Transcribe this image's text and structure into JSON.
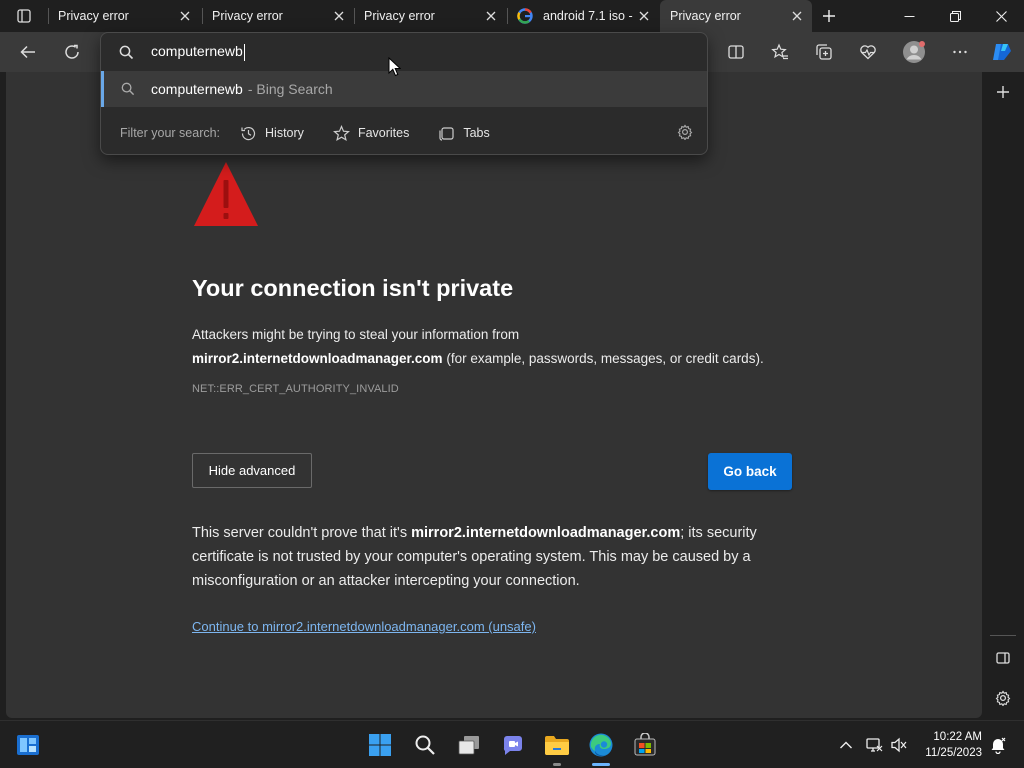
{
  "tabs": [
    {
      "title": "Privacy error",
      "favicon": "privacy-warning-icon"
    },
    {
      "title": "Privacy error",
      "favicon": "privacy-warning-icon"
    },
    {
      "title": "Privacy error",
      "favicon": "privacy-warning-icon"
    },
    {
      "title": "android 7.1 iso -",
      "favicon": "google-icon"
    },
    {
      "title": "Privacy error",
      "favicon": "privacy-warning-icon",
      "active": true
    }
  ],
  "omnibox": {
    "value": "computernewb",
    "suggestion_query": "computernewb",
    "suggestion_source": "- Bing Search",
    "filter_label": "Filter your search:",
    "filters": [
      "History",
      "Favorites",
      "Tabs"
    ]
  },
  "page": {
    "heading": "Your connection isn't private",
    "intro_before": "Attackers might be trying to steal your information from",
    "host": "mirror2.internetdownloadmanager.com",
    "intro_after": "(for example, passwords, messages, or credit cards).",
    "error_code": "NET::ERR_CERT_AUTHORITY_INVALID",
    "hide_advanced": "Hide advanced",
    "go_back": "Go back",
    "detail_before": "This server couldn't prove that it's",
    "detail_host": "mirror2.internetdownloadmanager.com",
    "detail_after": "; its security certificate is not trusted by your computer's operating system. This may be caused by a misconfiguration or an attacker intercepting your connection.",
    "proceed_link": "Continue to mirror2.internetdownloadmanager.com (unsafe)"
  },
  "taskbar": {
    "time": "10:22 AM",
    "date": "11/25/2023"
  },
  "colors": {
    "accent": "#0a72d6",
    "warning": "#d41c1c",
    "link": "#7db6f0"
  }
}
